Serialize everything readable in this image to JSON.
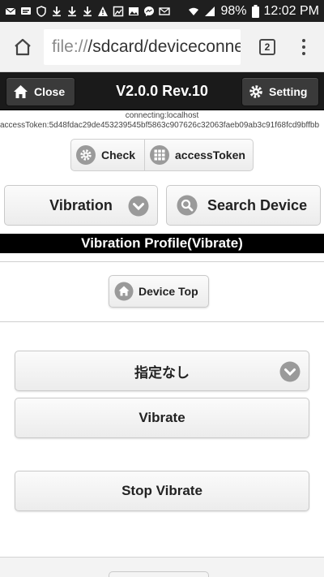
{
  "status_bar": {
    "battery": "98%",
    "time": "12:02 PM",
    "left_icons": [
      "mail-icon",
      "message-icon",
      "shield-icon",
      "download-icon",
      "download-icon",
      "download-icon",
      "warning-icon",
      "image-icon",
      "photo-icon",
      "messenger-icon",
      "email-icon"
    ],
    "right_icons": [
      "wifi-icon",
      "signal-icon",
      "battery-icon"
    ]
  },
  "browser": {
    "url_scheme": "file://",
    "url_rest": "/sdcard/deviceconne",
    "tab_count": "2"
  },
  "header": {
    "close_label": "Close",
    "title": "V2.0.0 Rev.10",
    "setting_label": "Setting"
  },
  "connection": {
    "status": "connecting:localhost",
    "access_token": "accessToken:5d48fdac29de453239545bf5863c907626c32063faeb09ab3c91f68fcd9bffbb"
  },
  "controls": {
    "check_label": "Check",
    "access_token_label": "accessToken"
  },
  "profile_select": {
    "selected": "Vibration"
  },
  "search_label": "Search Device",
  "profile_title": "Vibration Profile(Vibrate)",
  "device_top_label": "Device Top",
  "pattern_select": {
    "selected": "指定なし"
  },
  "vibrate_label": "Vibrate",
  "stop_vibrate_label": "Stop Vibrate",
  "colors": {
    "header_bg": "#1a1a1a",
    "icon_gray": "#9a9a9a"
  }
}
